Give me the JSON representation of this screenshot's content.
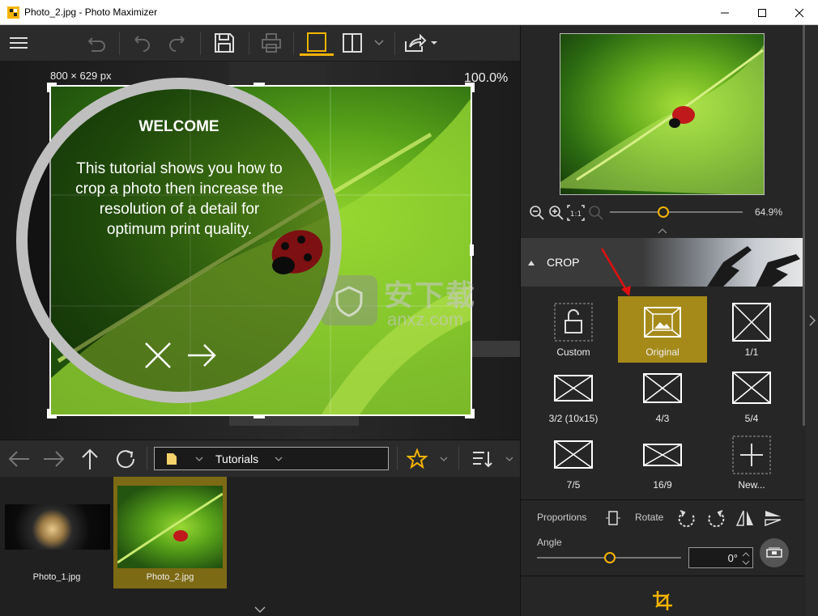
{
  "window": {
    "title": "Photo_2.jpg - Photo Maximizer"
  },
  "canvas": {
    "dimensions": "800 × 629 px",
    "zoom": "100.0%"
  },
  "tutorial": {
    "heading": "WELCOME",
    "body": "This tutorial shows you how to crop a photo then increase the resolution of a detail for optimum print quality."
  },
  "nav": {
    "folder": "Tutorials"
  },
  "thumbnails": [
    {
      "label": "Photo_1.jpg"
    },
    {
      "label": "Photo_2.jpg"
    }
  ],
  "preview": {
    "zoom": "64.9%"
  },
  "crop": {
    "title": "CROP",
    "options": [
      {
        "label": "Custom"
      },
      {
        "label": "Original"
      },
      {
        "label": "1/1"
      },
      {
        "label": "3/2 (10x15)"
      },
      {
        "label": "4/3"
      },
      {
        "label": "5/4"
      },
      {
        "label": "7/5"
      },
      {
        "label": "16/9"
      },
      {
        "label": "New..."
      }
    ]
  },
  "controls": {
    "proportions_label": "Proportions",
    "rotate_label": "Rotate",
    "angle_label": "Angle",
    "angle_value": "0°"
  },
  "watermark": {
    "cn": "安下载",
    "en": "anxz.com"
  },
  "colors": {
    "accent": "#f5b400",
    "selected": "#a58a1a",
    "background": "#262626"
  }
}
